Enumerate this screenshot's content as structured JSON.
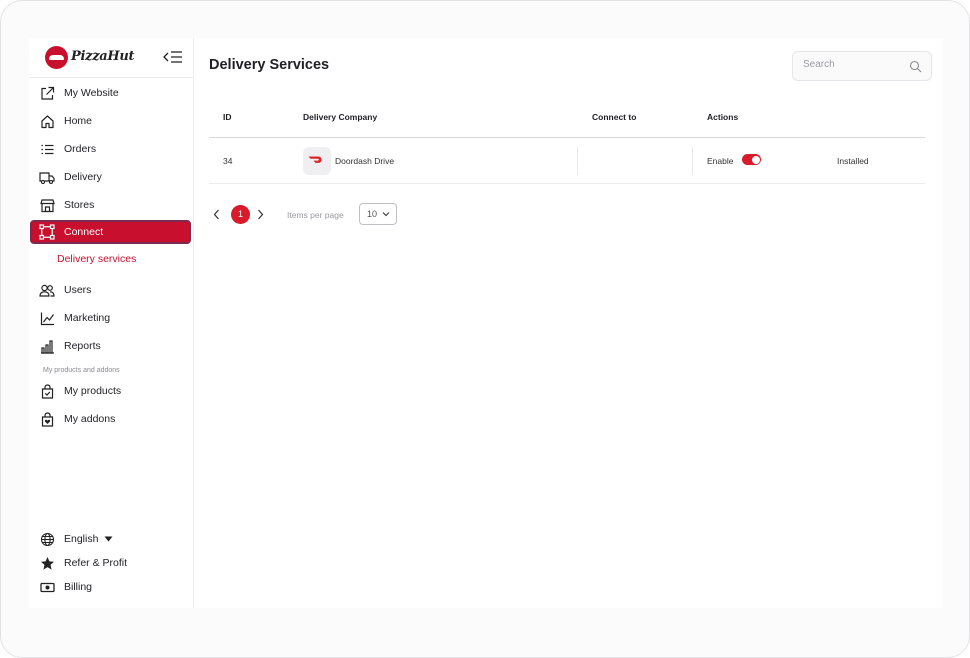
{
  "brand": {
    "name": "PizzaHut"
  },
  "sidebar": {
    "items": [
      {
        "label": "My Website",
        "icon": "external-link-icon"
      },
      {
        "label": "Home",
        "icon": "home-icon"
      },
      {
        "label": "Orders",
        "icon": "list-icon"
      },
      {
        "label": "Delivery",
        "icon": "truck-icon"
      },
      {
        "label": "Stores",
        "icon": "store-icon"
      },
      {
        "label": "Connect",
        "icon": "connect-icon",
        "active": true
      },
      {
        "label": "Users",
        "icon": "users-icon"
      },
      {
        "label": "Marketing",
        "icon": "chart-line-icon"
      },
      {
        "label": "Reports",
        "icon": "bar-chart-icon"
      }
    ],
    "sub_item": "Delivery services",
    "section_label": "My products and addons",
    "product_items": [
      {
        "label": "My products",
        "icon": "product-bag-icon"
      },
      {
        "label": "My addons",
        "icon": "addon-bag-icon"
      }
    ],
    "footer": [
      {
        "label": "English",
        "icon": "globe-icon"
      },
      {
        "label": "Refer & Profit",
        "icon": "star-icon"
      },
      {
        "label": "Billing",
        "icon": "billing-icon"
      }
    ]
  },
  "main": {
    "title": "Delivery Services",
    "search": {
      "placeholder": "Search"
    },
    "table": {
      "columns": [
        "ID",
        "Delivery Company",
        "Connect to",
        "Actions"
      ],
      "rows": [
        {
          "id": "34",
          "company": "Doordash Drive",
          "connect_to": "",
          "action_label": "Enable",
          "enabled": true,
          "status": "Installed"
        }
      ]
    },
    "pagination": {
      "current_page": "1",
      "items_per_page_label": "Items per page",
      "items_per_page": "10"
    }
  },
  "colors": {
    "accent": "#c8102e",
    "toggle": "#d81b2a",
    "active_border": "#7b2b4f"
  }
}
